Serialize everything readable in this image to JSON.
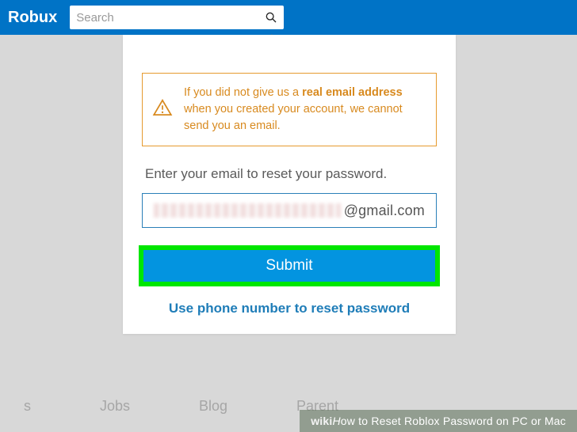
{
  "header": {
    "brand": "Robux",
    "search_placeholder": "Search"
  },
  "card": {
    "warning_prefix": "If you did not give us a ",
    "warning_bold": "real email address",
    "warning_suffix": " when you created your account, we cannot send you an email.",
    "instruction": "Enter your email to reset your password.",
    "email_domain": "@gmail.com",
    "submit_label": "Submit",
    "phone_link": "Use phone number to reset password"
  },
  "footer": {
    "items": [
      "s",
      "Jobs",
      "Blog",
      "Parent",
      "",
      "",
      ""
    ]
  },
  "overlay": {
    "brand1": "wiki",
    "brand2": "H",
    "text": "ow to Reset Roblox Password on PC or Mac"
  }
}
